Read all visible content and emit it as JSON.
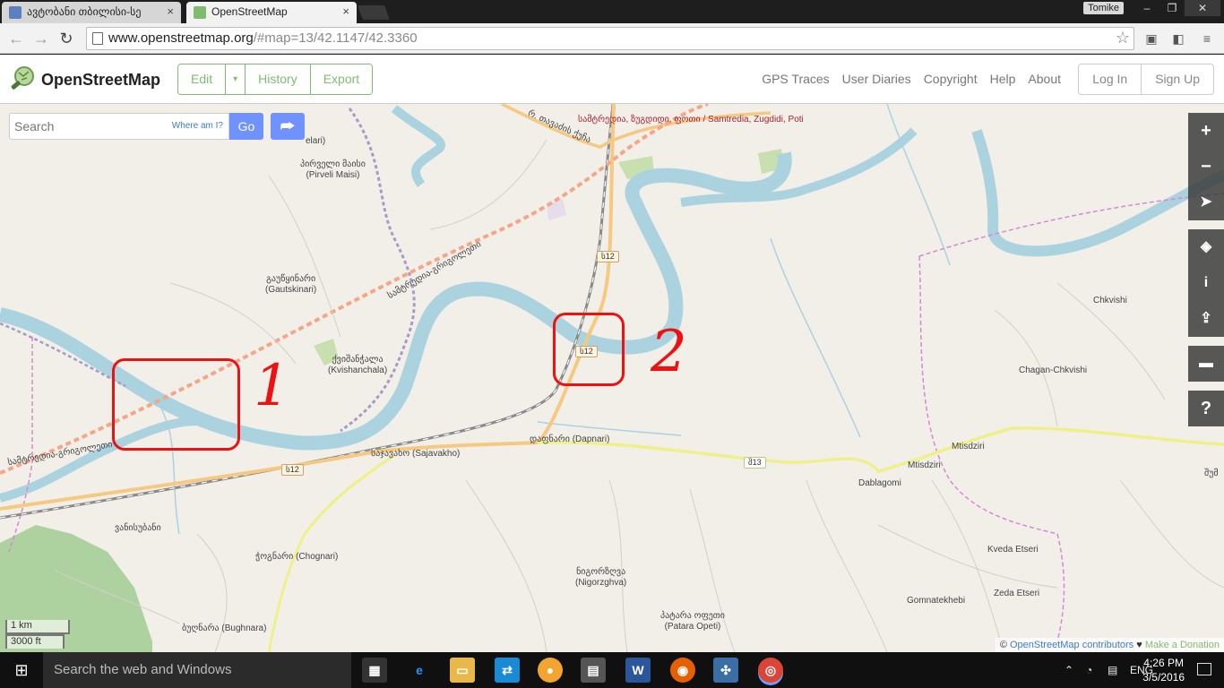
{
  "browser": {
    "tabs": [
      {
        "title": "ავტობანი თბილისი-სე",
        "active": false
      },
      {
        "title": "OpenStreetMap",
        "active": true
      }
    ],
    "tab_close": "×",
    "user_label": "Tomike",
    "url_host": "www.openstreetmap.org",
    "url_rest": "/#map=13/42.1147/42.3360",
    "star": "☆"
  },
  "osm": {
    "brand": "OpenStreetMap",
    "edit_label": "Edit",
    "edit_caret": "▾",
    "history_label": "History",
    "export_label": "Export",
    "nav_links": [
      "GPS Traces",
      "User Diaries",
      "Copyright",
      "Help",
      "About"
    ],
    "login_label": "Log In",
    "signup_label": "Sign Up",
    "search_placeholder": "Search",
    "where_am_i": "Where am I?",
    "go_label": "Go",
    "scale_km": "1 km",
    "scale_ft": "3000 ft",
    "attribution": {
      "prefix": "© ",
      "contributors": "OpenStreetMap contributors",
      "heart": " ♥ ",
      "donate": "Make a Donation"
    }
  },
  "map_labels": {
    "places": [
      "elari)",
      "პირველი მაისი\n(Pirveli Maisi)",
      "გაუწყინარი\n(Gautskinari)",
      "ქვიშანჭალა\n(Kvishanchala)",
      "დაფნარი (Dapnari)",
      "საჯავახო (Sajavakho)",
      "ჭოგნარი (Chognari)",
      "ნიგორზღვა\n(Nigorzghva)",
      "პატარა ოფეთი\n(Patara Opeti)",
      "ბუღნარა (Bughnara)",
      "ვანისუბანი",
      "Chkvishi",
      "Chagan-Chkvishi",
      "Mtisdziri",
      "Mtisdziri",
      "Dablagomi",
      "Kveda Etseri",
      "Zeda Etseri",
      "Gomnatekhebi",
      "შუმ"
    ],
    "roads": [
      "ს12",
      "ს12",
      "ს12",
      "შ13"
    ],
    "top_route": "სამტრედია, ზუგდიდი, ფოთი / Samtredia, Zugdidi, Poti",
    "top_street": "რ. თავაძის ქუჩა",
    "rail_label": "სამტრედია-გრიგოლეთი",
    "rail_label_2": "სამტრედია-გრიგოლეთი"
  },
  "annotations": [
    "1",
    "2"
  ],
  "taskbar": {
    "search_placeholder": "Search the web and Windows",
    "language": "ENG",
    "time": "4:26 PM",
    "date": "3/5/2016"
  },
  "colors": {
    "osm_green": "#7ebc6f",
    "go_blue": "#7092ff",
    "river": "#aad3df",
    "annotation_red": "#e11111"
  }
}
